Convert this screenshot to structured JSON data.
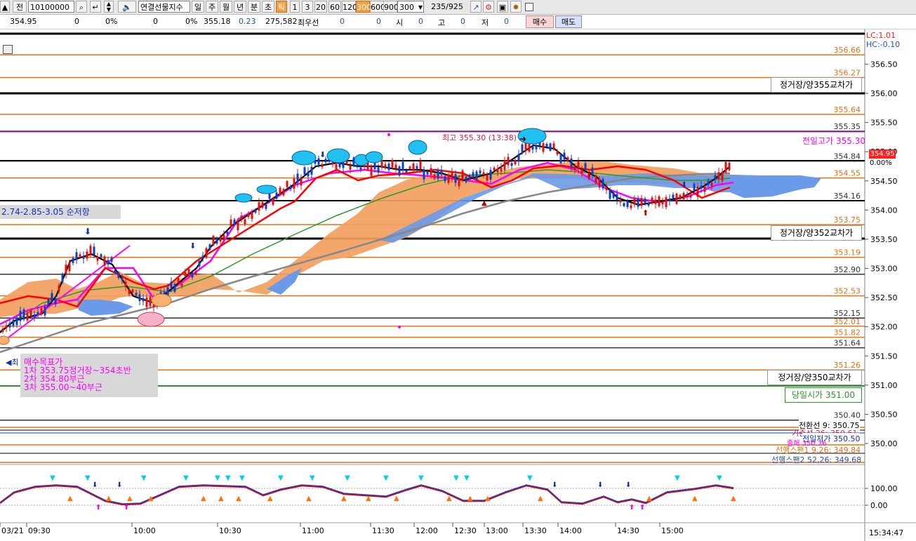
{
  "toolbar": {
    "prefix": "전",
    "code": "10100000",
    "name": "연결선물지수",
    "periods": [
      "일",
      "주",
      "월",
      "년",
      "분",
      "초",
      "틱"
    ],
    "intervals": [
      "1",
      "3",
      "20",
      "60",
      "120",
      "300",
      "600",
      "900"
    ],
    "count": "300",
    "page": "235/925"
  },
  "quote": {
    "price": "354.95",
    "f1": "0",
    "f2": "0%",
    "f3": "0",
    "f4": "0%",
    "f5": "355.18",
    "change": "0.23",
    "volume": "275,582",
    "best_label": "최우선",
    "best_value": "0",
    "f6": "0",
    "open_label": "시",
    "open_value": "0",
    "high_label": "고",
    "high_value": "0",
    "low_label": "저",
    "low_value": "0",
    "buy": "매수",
    "sell": "매도"
  },
  "chart": {
    "lc": "LC:1.01",
    "hc": "HC:-0.10",
    "last_price": "354.95",
    "pct": "0.00%",
    "high_label": "최고 355.30 (13:38)",
    "prev_high": "전일고가 355.30",
    "open_label": "당일시가 351.00",
    "low_label": "최",
    "box1": "정거장/양355교차가",
    "box2": "정거장/양352교차가",
    "box3": "정거장/양350교차가",
    "support_note": "2.74-2.85-3.05 순저항",
    "targets": {
      "t0": "매수목표가",
      "t1": "1차 353.75정거장~354초반",
      "t2": "2차 354.80부근",
      "t3": "3차 355.00~40부근"
    },
    "bottom_labels": {
      "b1": "전환선 9: 350.75",
      "b2": "기준선 26: 350.61",
      "b3": "전일저가 350.50",
      "b4": "출해 350.36",
      "b5": "선행스팬1 9,26: 349.84",
      "b6": "선행스팬2 52,26: 349.68"
    },
    "axis_ticks": [
      "356.50",
      "356.00",
      "355.50",
      "355.00",
      "354.50",
      "354.00",
      "353.50",
      "353.00",
      "352.50",
      "352.00",
      "351.50",
      "351.00",
      "350.50",
      "350.00"
    ],
    "levels": [
      {
        "label": "356.66",
        "price": 356.66,
        "color": "#e87010"
      },
      {
        "label": "356.27",
        "price": 356.27,
        "color": "#e87010"
      },
      {
        "label": "355.64",
        "price": 355.64,
        "color": "#e87010"
      },
      {
        "label": "355.35",
        "price": 355.35,
        "color": "#333333"
      },
      {
        "label": "354.84",
        "price": 354.84,
        "color": "#333333"
      },
      {
        "label": "354.55",
        "price": 354.55,
        "color": "#e87010"
      },
      {
        "label": "354.16",
        "price": 354.16,
        "color": "#333333"
      },
      {
        "label": "353.75",
        "price": 353.75,
        "color": "#e87010"
      },
      {
        "label": "353.19",
        "price": 353.19,
        "color": "#e87010"
      },
      {
        "label": "352.90",
        "price": 352.9,
        "color": "#333333"
      },
      {
        "label": "352.53",
        "price": 352.53,
        "color": "#e87010"
      },
      {
        "label": "352.15",
        "price": 352.15,
        "color": "#333333"
      },
      {
        "label": "352.01",
        "price": 352.01,
        "color": "#e87010"
      },
      {
        "label": "351.82",
        "price": 351.82,
        "color": "#e87010"
      },
      {
        "label": "351.64",
        "price": 351.64,
        "color": "#333333"
      },
      {
        "label": "351.26",
        "price": 351.26,
        "color": "#e87010"
      },
      {
        "label": "350.40",
        "price": 350.4,
        "color": "#333333"
      }
    ],
    "osc_ticks": [
      "100.00",
      "0.00"
    ],
    "time_labels": [
      "03/21",
      "09:30",
      "10:00",
      "10:30",
      "11:00",
      "11:30",
      "12:00",
      "12:30",
      "13:00",
      "13:30",
      "14:00",
      "14:30",
      "15:00"
    ],
    "clock": "15:34:47",
    "colors": {
      "orange": "#e87010",
      "black": "#000000",
      "magenta": "#ff00ff",
      "red": "#ff0000",
      "cloud_up": "#f2a060",
      "cloud_down": "#6b9ae8",
      "ma_gray": "#888888",
      "ma_green": "#2a9a2a"
    }
  }
}
